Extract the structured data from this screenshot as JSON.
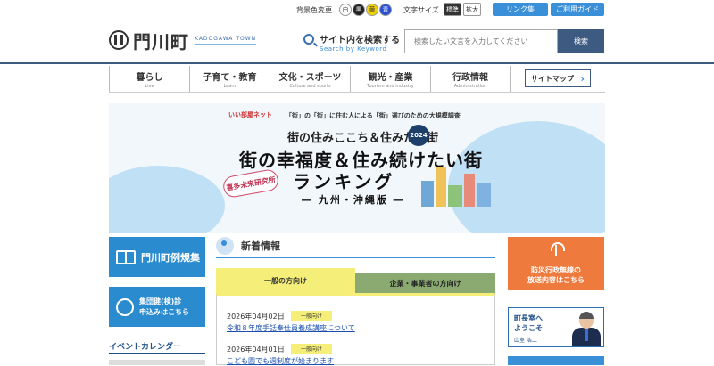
{
  "topbar": {
    "bg_color_label": "背景色変更",
    "colors": [
      {
        "label": "白",
        "bg": "#ffffff",
        "fg": "#333333"
      },
      {
        "label": "黒",
        "bg": "#222222",
        "fg": "#ffffff"
      },
      {
        "label": "黄",
        "bg": "#f2d300",
        "fg": "#333333"
      },
      {
        "label": "青",
        "bg": "#2a4fd0",
        "fg": "#ffffff"
      }
    ],
    "font_size_label": "文字サイズ",
    "font_standard": "標準",
    "font_large": "拡大",
    "links_label": "リンク集",
    "guide_label": "ご利用ガイド"
  },
  "header": {
    "logo_name": "門川町",
    "logo_sub": "KADOGAWA TOWN",
    "search_title": "サイト内を検索する",
    "search_sub": "Search by Keyword",
    "search_placeholder": "検索したい文言を入力してください",
    "search_button": "検索"
  },
  "nav": {
    "items": [
      {
        "label": "暮らし",
        "sub": "Live"
      },
      {
        "label": "子育て・教育",
        "sub": "Learn"
      },
      {
        "label": "文化・スポーツ",
        "sub": "Culture and sports"
      },
      {
        "label": "観光・産業",
        "sub": "Tourism and industry"
      },
      {
        "label": "行政情報",
        "sub": "Administration"
      }
    ],
    "sitemap_label": "サイトマップ"
  },
  "banner": {
    "brand": "いい部屋ネット",
    "line1": "「街」の「街」に住む人による「街」選びのための大規模調査",
    "line2": "街の住みここち＆住みたい街",
    "year": "2024",
    "title1": "街の幸福度＆住み続けたい街",
    "title2": "ランキング",
    "region": "― 九州・沖縄版 ―",
    "badge": "喜多未来研究所"
  },
  "sidebar": {
    "regulations": "門川町例規集",
    "checkup_line1": "集団健(検)診",
    "checkup_line2": "申込みはこちら",
    "event_calendar": "イベントカレンダー"
  },
  "news": {
    "title": "新着情報",
    "tab_general": "一般の方向け",
    "tab_business": "企業・事業者の方向け",
    "items": [
      {
        "date": "2026年04月02日",
        "tag": "一般向け",
        "title": "令和８年度手話奉仕員養成講座について"
      },
      {
        "date": "2026年04月01日",
        "tag": "一般向け",
        "title": "こども園でも週制度が始まります"
      }
    ]
  },
  "right": {
    "disaster_line1": "防災行政無線の",
    "disaster_line2": "放送内容はこちら",
    "mayor_line1": "町長室へ",
    "mayor_line2": "ようこそ",
    "mayor_name": "山室 浩二"
  }
}
